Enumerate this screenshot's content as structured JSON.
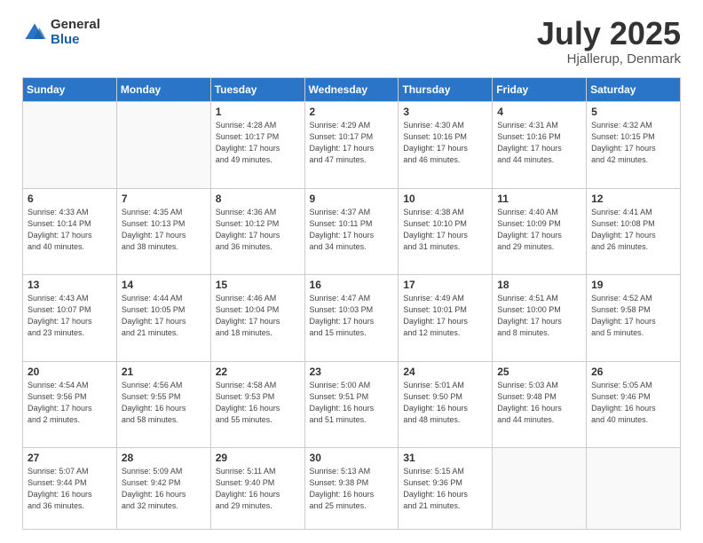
{
  "logo": {
    "general": "General",
    "blue": "Blue"
  },
  "title": "July 2025",
  "location": "Hjallerup, Denmark",
  "days_of_week": [
    "Sunday",
    "Monday",
    "Tuesday",
    "Wednesday",
    "Thursday",
    "Friday",
    "Saturday"
  ],
  "weeks": [
    [
      {
        "day": "",
        "info": ""
      },
      {
        "day": "",
        "info": ""
      },
      {
        "day": "1",
        "info": "Sunrise: 4:28 AM\nSunset: 10:17 PM\nDaylight: 17 hours\nand 49 minutes."
      },
      {
        "day": "2",
        "info": "Sunrise: 4:29 AM\nSunset: 10:17 PM\nDaylight: 17 hours\nand 47 minutes."
      },
      {
        "day": "3",
        "info": "Sunrise: 4:30 AM\nSunset: 10:16 PM\nDaylight: 17 hours\nand 46 minutes."
      },
      {
        "day": "4",
        "info": "Sunrise: 4:31 AM\nSunset: 10:16 PM\nDaylight: 17 hours\nand 44 minutes."
      },
      {
        "day": "5",
        "info": "Sunrise: 4:32 AM\nSunset: 10:15 PM\nDaylight: 17 hours\nand 42 minutes."
      }
    ],
    [
      {
        "day": "6",
        "info": "Sunrise: 4:33 AM\nSunset: 10:14 PM\nDaylight: 17 hours\nand 40 minutes."
      },
      {
        "day": "7",
        "info": "Sunrise: 4:35 AM\nSunset: 10:13 PM\nDaylight: 17 hours\nand 38 minutes."
      },
      {
        "day": "8",
        "info": "Sunrise: 4:36 AM\nSunset: 10:12 PM\nDaylight: 17 hours\nand 36 minutes."
      },
      {
        "day": "9",
        "info": "Sunrise: 4:37 AM\nSunset: 10:11 PM\nDaylight: 17 hours\nand 34 minutes."
      },
      {
        "day": "10",
        "info": "Sunrise: 4:38 AM\nSunset: 10:10 PM\nDaylight: 17 hours\nand 31 minutes."
      },
      {
        "day": "11",
        "info": "Sunrise: 4:40 AM\nSunset: 10:09 PM\nDaylight: 17 hours\nand 29 minutes."
      },
      {
        "day": "12",
        "info": "Sunrise: 4:41 AM\nSunset: 10:08 PM\nDaylight: 17 hours\nand 26 minutes."
      }
    ],
    [
      {
        "day": "13",
        "info": "Sunrise: 4:43 AM\nSunset: 10:07 PM\nDaylight: 17 hours\nand 23 minutes."
      },
      {
        "day": "14",
        "info": "Sunrise: 4:44 AM\nSunset: 10:05 PM\nDaylight: 17 hours\nand 21 minutes."
      },
      {
        "day": "15",
        "info": "Sunrise: 4:46 AM\nSunset: 10:04 PM\nDaylight: 17 hours\nand 18 minutes."
      },
      {
        "day": "16",
        "info": "Sunrise: 4:47 AM\nSunset: 10:03 PM\nDaylight: 17 hours\nand 15 minutes."
      },
      {
        "day": "17",
        "info": "Sunrise: 4:49 AM\nSunset: 10:01 PM\nDaylight: 17 hours\nand 12 minutes."
      },
      {
        "day": "18",
        "info": "Sunrise: 4:51 AM\nSunset: 10:00 PM\nDaylight: 17 hours\nand 8 minutes."
      },
      {
        "day": "19",
        "info": "Sunrise: 4:52 AM\nSunset: 9:58 PM\nDaylight: 17 hours\nand 5 minutes."
      }
    ],
    [
      {
        "day": "20",
        "info": "Sunrise: 4:54 AM\nSunset: 9:56 PM\nDaylight: 17 hours\nand 2 minutes."
      },
      {
        "day": "21",
        "info": "Sunrise: 4:56 AM\nSunset: 9:55 PM\nDaylight: 16 hours\nand 58 minutes."
      },
      {
        "day": "22",
        "info": "Sunrise: 4:58 AM\nSunset: 9:53 PM\nDaylight: 16 hours\nand 55 minutes."
      },
      {
        "day": "23",
        "info": "Sunrise: 5:00 AM\nSunset: 9:51 PM\nDaylight: 16 hours\nand 51 minutes."
      },
      {
        "day": "24",
        "info": "Sunrise: 5:01 AM\nSunset: 9:50 PM\nDaylight: 16 hours\nand 48 minutes."
      },
      {
        "day": "25",
        "info": "Sunrise: 5:03 AM\nSunset: 9:48 PM\nDaylight: 16 hours\nand 44 minutes."
      },
      {
        "day": "26",
        "info": "Sunrise: 5:05 AM\nSunset: 9:46 PM\nDaylight: 16 hours\nand 40 minutes."
      }
    ],
    [
      {
        "day": "27",
        "info": "Sunrise: 5:07 AM\nSunset: 9:44 PM\nDaylight: 16 hours\nand 36 minutes."
      },
      {
        "day": "28",
        "info": "Sunrise: 5:09 AM\nSunset: 9:42 PM\nDaylight: 16 hours\nand 32 minutes."
      },
      {
        "day": "29",
        "info": "Sunrise: 5:11 AM\nSunset: 9:40 PM\nDaylight: 16 hours\nand 29 minutes."
      },
      {
        "day": "30",
        "info": "Sunrise: 5:13 AM\nSunset: 9:38 PM\nDaylight: 16 hours\nand 25 minutes."
      },
      {
        "day": "31",
        "info": "Sunrise: 5:15 AM\nSunset: 9:36 PM\nDaylight: 16 hours\nand 21 minutes."
      },
      {
        "day": "",
        "info": ""
      },
      {
        "day": "",
        "info": ""
      }
    ]
  ]
}
